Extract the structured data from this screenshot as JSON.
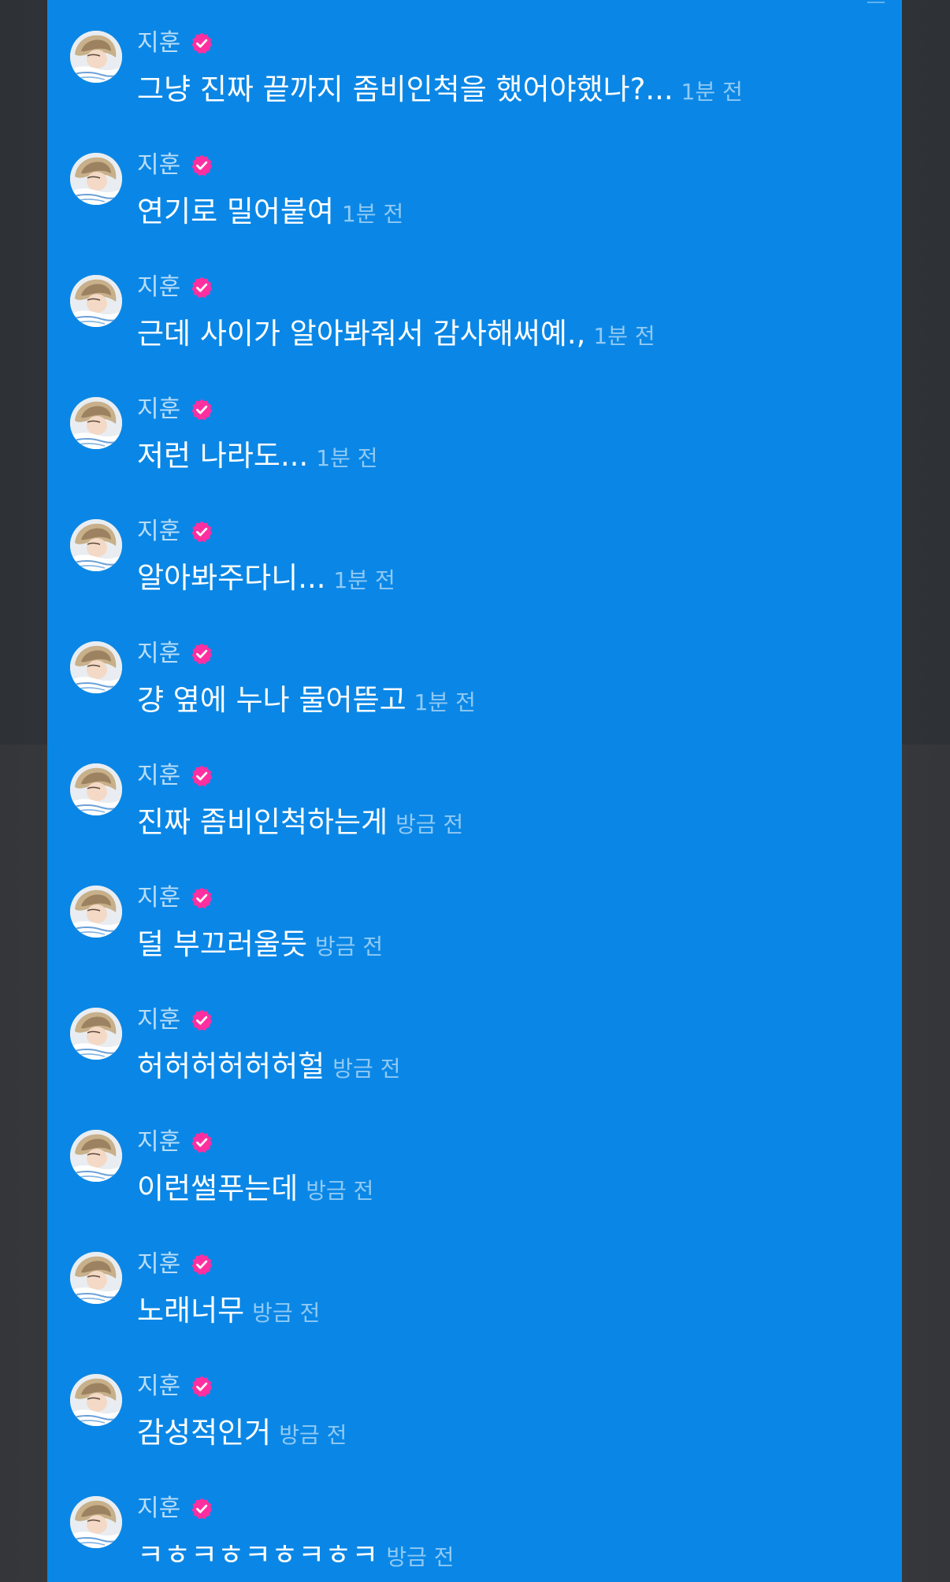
{
  "colors": {
    "panel": "#0a87e6",
    "badge": "#ff2fa0",
    "text": "#ffffff",
    "muted": "rgba(255,255,255,0.55)"
  },
  "icons": {
    "avatar": "profile-photo",
    "badge": "verified-check-icon"
  },
  "messages": [
    {
      "user": "지훈",
      "text": "그냥 진짜 끝까지 좀비인척을 했어야했나?...",
      "time": "1분 전"
    },
    {
      "user": "지훈",
      "text": "연기로 밀어붙여",
      "time": "1분 전"
    },
    {
      "user": "지훈",
      "text": "근데 사이가 알아봐줘서 감사해써예.,",
      "time": "1분 전"
    },
    {
      "user": "지훈",
      "text": "저런 나라도...",
      "time": "1분 전"
    },
    {
      "user": "지훈",
      "text": "알아봐주다니...",
      "time": "1분 전"
    },
    {
      "user": "지훈",
      "text": "걍 옆에 누나 물어뜯고",
      "time": "1분 전"
    },
    {
      "user": "지훈",
      "text": "진짜 좀비인척하는게",
      "time": "방금 전"
    },
    {
      "user": "지훈",
      "text": "덜 부끄러울듯",
      "time": "방금 전"
    },
    {
      "user": "지훈",
      "text": "허허허허허허헐",
      "time": "방금 전"
    },
    {
      "user": "지훈",
      "text": "이런썰푸는데",
      "time": "방금 전"
    },
    {
      "user": "지훈",
      "text": "노래너무",
      "time": "방금 전"
    },
    {
      "user": "지훈",
      "text": "감성적인거",
      "time": "방금 전"
    },
    {
      "user": "지훈",
      "text": "ㅋㅎㅋㅎㅋㅎㅋㅎㅋ",
      "time": "방금 전"
    }
  ]
}
